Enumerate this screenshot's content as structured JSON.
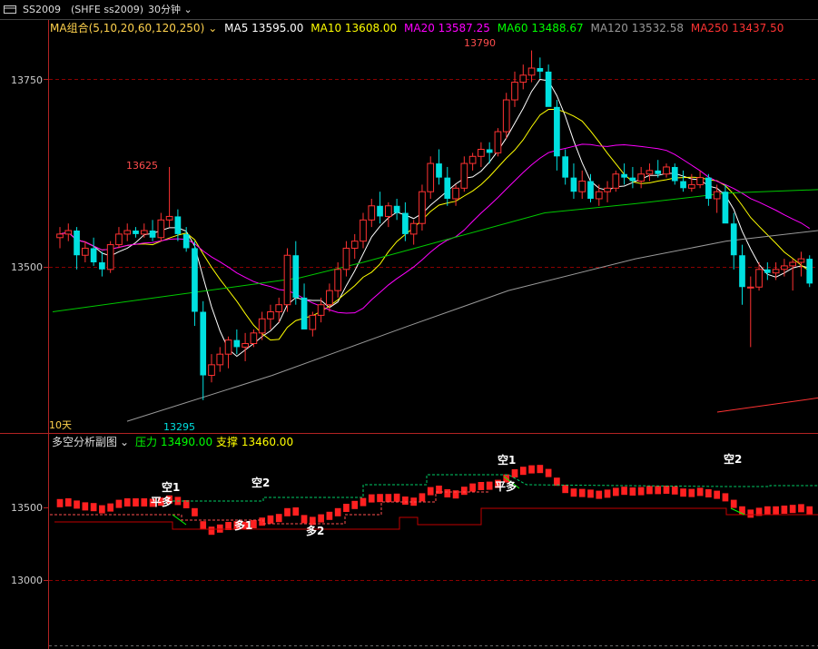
{
  "toolbar": {
    "symbol": "SS2009",
    "exchange": "(SHFE ss2009)",
    "period": "30分钟",
    "period_arrow": "chevron-down-icon"
  },
  "ma_legend": {
    "group_label": "MA组合(5,10,20,60,120,250)",
    "items": [
      {
        "label": "MA5 13595.00",
        "color": "#ffffff"
      },
      {
        "label": "MA10 13608.00",
        "color": "#ffff00"
      },
      {
        "label": "MA20 13587.25",
        "color": "#ff00ff"
      },
      {
        "label": "MA60 13488.67",
        "color": "#00ff00"
      },
      {
        "label": "MA120 13532.58",
        "color": "#999999"
      },
      {
        "label": "MA250 13437.50",
        "color": "#ff3333"
      }
    ]
  },
  "main_chart": {
    "y_ticks": [
      "13750",
      "13500"
    ],
    "high_label": "13790",
    "low_label": "13295",
    "local_high_label": "13625",
    "corner_label": "10天"
  },
  "sub_chart": {
    "title": "多空分析副图",
    "pressure": "压力 13490.00",
    "support": "支撑 13460.00",
    "y_ticks": [
      "13500",
      "13000"
    ],
    "signals": [
      "空1",
      "平多",
      "多1",
      "空2",
      "多2",
      "空1",
      "平多",
      "空2"
    ]
  },
  "colors": {
    "up": "#ff3232",
    "down": "#00e0e0",
    "grid": "#8b0000",
    "axis": "#b22222"
  },
  "chart_data": {
    "type": "candlestick",
    "candles": [
      [
        13525,
        13540,
        13510,
        13530
      ],
      [
        13530,
        13545,
        13520,
        13535
      ],
      [
        13535,
        13540,
        13480,
        13500
      ],
      [
        13500,
        13520,
        13490,
        13510
      ],
      [
        13510,
        13525,
        13485,
        13490
      ],
      [
        13490,
        13505,
        13470,
        13480
      ],
      [
        13480,
        13520,
        13475,
        13515
      ],
      [
        13515,
        13540,
        13510,
        13530
      ],
      [
        13530,
        13545,
        13520,
        13535
      ],
      [
        13535,
        13540,
        13525,
        13530
      ],
      [
        13530,
        13545,
        13525,
        13535
      ],
      [
        13535,
        13550,
        13520,
        13525
      ],
      [
        13525,
        13560,
        13520,
        13550
      ],
      [
        13550,
        13625,
        13540,
        13555
      ],
      [
        13555,
        13565,
        13520,
        13530
      ],
      [
        13530,
        13540,
        13505,
        13510
      ],
      [
        13510,
        13520,
        13400,
        13420
      ],
      [
        13420,
        13435,
        13295,
        13330
      ],
      [
        13330,
        13360,
        13320,
        13345
      ],
      [
        13345,
        13370,
        13335,
        13360
      ],
      [
        13360,
        13385,
        13340,
        13380
      ],
      [
        13380,
        13395,
        13360,
        13370
      ],
      [
        13370,
        13390,
        13350,
        13375
      ],
      [
        13375,
        13395,
        13370,
        13390
      ],
      [
        13390,
        13420,
        13380,
        13410
      ],
      [
        13410,
        13430,
        13395,
        13420
      ],
      [
        13420,
        13440,
        13405,
        13430
      ],
      [
        13430,
        13510,
        13420,
        13500
      ],
      [
        13500,
        13520,
        13430,
        13440
      ],
      [
        13440,
        13460,
        13400,
        13395
      ],
      [
        13395,
        13420,
        13385,
        13415
      ],
      [
        13415,
        13440,
        13405,
        13430
      ],
      [
        13430,
        13460,
        13420,
        13450
      ],
      [
        13450,
        13490,
        13440,
        13480
      ],
      [
        13480,
        13520,
        13470,
        13510
      ],
      [
        13510,
        13530,
        13495,
        13520
      ],
      [
        13520,
        13560,
        13510,
        13550
      ],
      [
        13550,
        13580,
        13540,
        13570
      ],
      [
        13570,
        13590,
        13545,
        13555
      ],
      [
        13555,
        13575,
        13540,
        13570
      ],
      [
        13570,
        13580,
        13550,
        13560
      ],
      [
        13560,
        13575,
        13520,
        13530
      ],
      [
        13530,
        13550,
        13515,
        13545
      ],
      [
        13545,
        13600,
        13535,
        13590
      ],
      [
        13590,
        13640,
        13580,
        13630
      ],
      [
        13630,
        13650,
        13600,
        13610
      ],
      [
        13610,
        13625,
        13570,
        13580
      ],
      [
        13580,
        13600,
        13570,
        13595
      ],
      [
        13595,
        13640,
        13590,
        13630
      ],
      [
        13630,
        13645,
        13620,
        13640
      ],
      [
        13640,
        13660,
        13625,
        13650
      ],
      [
        13650,
        13660,
        13630,
        13645
      ],
      [
        13645,
        13680,
        13640,
        13675
      ],
      [
        13675,
        13730,
        13665,
        13720
      ],
      [
        13720,
        13760,
        13710,
        13745
      ],
      [
        13745,
        13770,
        13735,
        13755
      ],
      [
        13755,
        13790,
        13745,
        13765
      ],
      [
        13765,
        13780,
        13750,
        13760
      ],
      [
        13760,
        13770,
        13730,
        13710
      ],
      [
        13710,
        13720,
        13620,
        13640
      ],
      [
        13640,
        13650,
        13600,
        13610
      ],
      [
        13610,
        13630,
        13580,
        13590
      ],
      [
        13590,
        13620,
        13580,
        13605
      ],
      [
        13605,
        13615,
        13575,
        13580
      ],
      [
        13580,
        13600,
        13570,
        13590
      ],
      [
        13590,
        13605,
        13575,
        13595
      ],
      [
        13595,
        13620,
        13590,
        13615
      ],
      [
        13615,
        13630,
        13600,
        13610
      ],
      [
        13610,
        13625,
        13595,
        13605
      ],
      [
        13605,
        13625,
        13595,
        13615
      ],
      [
        13615,
        13630,
        13605,
        13620
      ],
      [
        13620,
        13635,
        13610,
        13615
      ],
      [
        13615,
        13630,
        13610,
        13625
      ],
      [
        13625,
        13630,
        13600,
        13605
      ],
      [
        13605,
        13620,
        13590,
        13595
      ],
      [
        13595,
        13615,
        13590,
        13600
      ],
      [
        13600,
        13620,
        13595,
        13610
      ],
      [
        13610,
        13615,
        13570,
        13580
      ],
      [
        13580,
        13600,
        13560,
        13590
      ],
      [
        13590,
        13600,
        13565,
        13545
      ],
      [
        13545,
        13560,
        13480,
        13500
      ],
      [
        13500,
        13515,
        13430,
        13455
      ],
      [
        13455,
        13470,
        13370,
        13455
      ],
      [
        13455,
        13490,
        13450,
        13480
      ],
      [
        13480,
        13490,
        13465,
        13475
      ],
      [
        13475,
        13490,
        13465,
        13480
      ],
      [
        13480,
        13495,
        13470,
        13485
      ],
      [
        13485,
        13495,
        13450,
        13490
      ],
      [
        13490,
        13505,
        13470,
        13495
      ],
      [
        13495,
        13500,
        13455,
        13460
      ]
    ],
    "ylim": [
      13260,
      13810
    ]
  }
}
